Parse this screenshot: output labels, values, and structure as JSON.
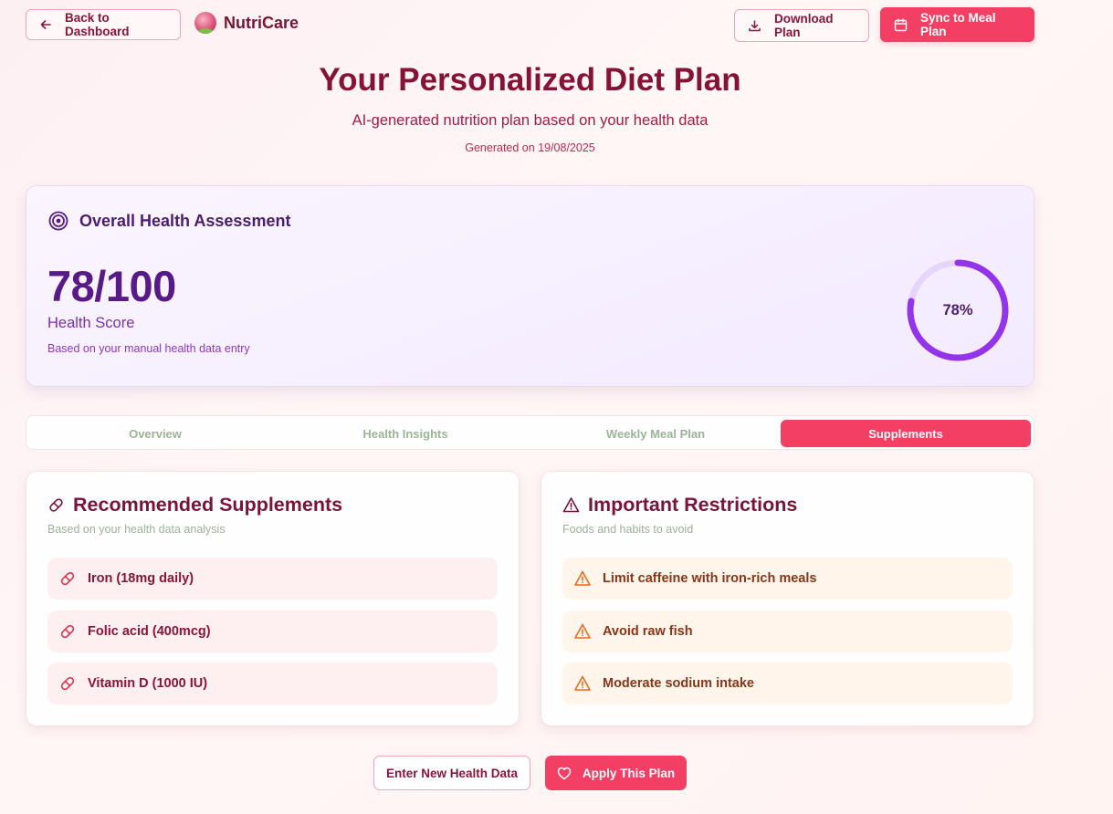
{
  "topbar": {
    "back_label": "Back to Dashboard",
    "brand": "NutriCare",
    "download_label": "Download Plan",
    "sync_label": "Sync to Meal Plan"
  },
  "header": {
    "title": "Your Personalized Diet Plan",
    "subtitle": "AI-generated nutrition plan based on your health data",
    "generated": "Generated on 19/08/2025"
  },
  "health": {
    "title": "Overall Health Assessment",
    "score": "78/100",
    "score_label": "Health Score",
    "note": "Based on your manual health data entry",
    "percent_text": "78%",
    "percent_value": 78
  },
  "tabs": [
    {
      "label": "Overview",
      "active": false
    },
    {
      "label": "Health Insights",
      "active": false
    },
    {
      "label": "Weekly Meal Plan",
      "active": false
    },
    {
      "label": "Supplements",
      "active": true
    }
  ],
  "supplements": {
    "title": "Recommended Supplements",
    "subtitle": "Based on your health data analysis",
    "items": [
      "Iron (18mg daily)",
      "Folic acid (400mcg)",
      "Vitamin D (1000 IU)"
    ]
  },
  "restrictions": {
    "title": "Important Restrictions",
    "subtitle": "Foods and habits to avoid",
    "items": [
      "Limit caffeine with iron-rich meals",
      "Avoid raw fish",
      "Moderate sodium intake"
    ]
  },
  "footer": {
    "new_data_label": "Enter New Health Data",
    "apply_label": "Apply This Plan"
  },
  "colors": {
    "primary": "#f23f63",
    "brand_text": "#851338",
    "health_purple": "#571a86",
    "ring": "#9333ea",
    "restriction_icon": "#ea6a1f"
  },
  "icons": {
    "back": "arrow-left-icon",
    "download": "download-icon",
    "sync": "calendar-icon",
    "health": "target-icon",
    "supplement": "pill-icon",
    "restriction": "warning-icon",
    "apply": "heart-icon"
  }
}
